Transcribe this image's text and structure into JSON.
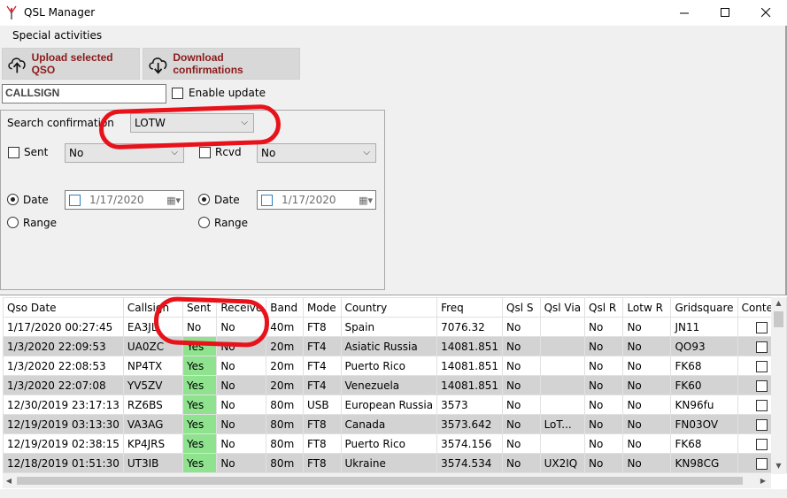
{
  "window": {
    "title": "QSL Manager",
    "controls": {
      "minimize": "—",
      "maximize": "☐",
      "close": "✕"
    }
  },
  "menu": {
    "items": [
      "Special activities"
    ]
  },
  "toolbar": {
    "upload_label": "Upload selected QSO",
    "download_label": "Download confirmations"
  },
  "callsign": {
    "value": "CALLSIGN"
  },
  "enable_update": {
    "label": "Enable update",
    "checked": false
  },
  "search": {
    "confirmation_label": "Search confirmation",
    "confirmation_value": "LOTW",
    "sent_label": "Sent",
    "sent_value": "No",
    "rcvd_label": "Rcvd",
    "rcvd_value": "No",
    "date_label": "Date",
    "range_label": "Range",
    "left_date": "1/17/2020",
    "right_date": "1/17/2020",
    "left_mode": "Date",
    "right_mode": "Date"
  },
  "grid": {
    "columns": [
      "Qso Date",
      "Callsign",
      "Sent",
      "Receive",
      "Band",
      "Mode",
      "Country",
      "Freq",
      "Qsl S",
      "Qsl Via",
      "Qsl R",
      "Lotw R",
      "Gridsquare",
      "Contest"
    ],
    "rows": [
      [
        "1/17/2020 00:27:45",
        "EA3JL",
        "No",
        "No",
        "40m",
        "FT8",
        "Spain",
        "7076.32",
        "No",
        "",
        "No",
        "No",
        "JN11"
      ],
      [
        "1/3/2020 22:09:53",
        "UA0ZC",
        "Yes",
        "No",
        "20m",
        "FT4",
        "Asiatic Russia",
        "14081.851",
        "No",
        "",
        "No",
        "No",
        "QO93"
      ],
      [
        "1/3/2020 22:08:53",
        "NP4TX",
        "Yes",
        "No",
        "20m",
        "FT4",
        "Puerto Rico",
        "14081.851",
        "No",
        "",
        "No",
        "No",
        "FK68"
      ],
      [
        "1/3/2020 22:07:08",
        "YV5ZV",
        "Yes",
        "No",
        "20m",
        "FT4",
        "Venezuela",
        "14081.851",
        "No",
        "",
        "No",
        "No",
        "FK60"
      ],
      [
        "12/30/2019 23:17:13",
        "RZ6BS",
        "Yes",
        "No",
        "80m",
        "USB",
        "European Russia",
        "3573",
        "No",
        "",
        "No",
        "No",
        "KN96fu"
      ],
      [
        "12/19/2019 03:13:30",
        "VA3AG",
        "Yes",
        "No",
        "80m",
        "FT8",
        "Canada",
        "3573.642",
        "No",
        "LoT...",
        "No",
        "No",
        "FN03OV"
      ],
      [
        "12/19/2019 02:38:15",
        "KP4JRS",
        "Yes",
        "No",
        "80m",
        "FT8",
        "Puerto Rico",
        "3574.156",
        "No",
        "",
        "No",
        "No",
        "FK68"
      ],
      [
        "12/18/2019 01:51:30",
        "UT3IB",
        "Yes",
        "No",
        "80m",
        "FT8",
        "Ukraine",
        "3574.534",
        "No",
        "UX2IQ",
        "No",
        "No",
        "KN98CG"
      ]
    ]
  },
  "colors": {
    "sent_yes": "#8fe38f",
    "toolbar_text": "#8b1a1a",
    "annotation_red": "#e8121b"
  },
  "icons": {
    "upload": "upload-cloud-icon",
    "download": "download-cloud-icon",
    "app": "antenna-icon",
    "calendar": "calendar-icon"
  }
}
